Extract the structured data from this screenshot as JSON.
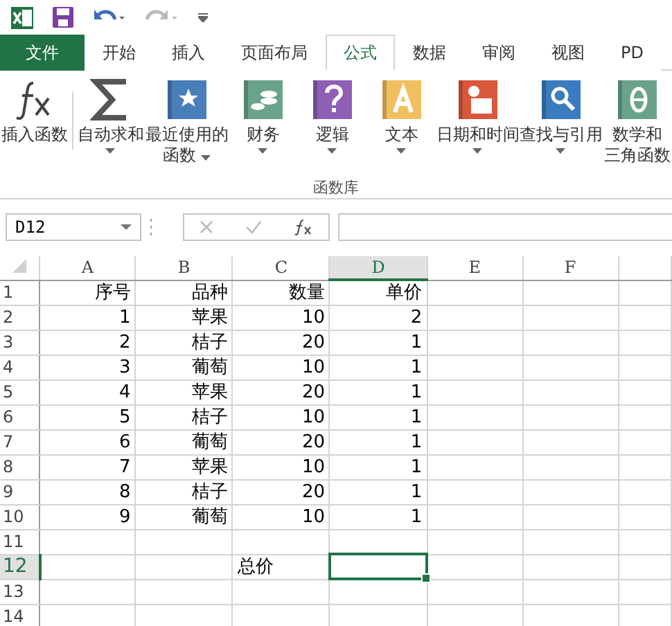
{
  "tabs": [
    {
      "label": "文件",
      "kind": "file",
      "selected": false
    },
    {
      "label": "开始",
      "kind": "tab",
      "selected": false
    },
    {
      "label": "插入",
      "kind": "tab",
      "selected": false
    },
    {
      "label": "页面布局",
      "kind": "tab",
      "selected": false
    },
    {
      "label": "公式",
      "kind": "tab",
      "selected": true
    },
    {
      "label": "数据",
      "kind": "tab",
      "selected": false
    },
    {
      "label": "审阅",
      "kind": "tab",
      "selected": false
    },
    {
      "label": "视图",
      "kind": "tab",
      "selected": false
    },
    {
      "label": "PD",
      "kind": "tab",
      "selected": false
    }
  ],
  "ribbon": {
    "group_label": "函数库",
    "items": [
      {
        "kind": "fx",
        "lines": [
          "插入函数"
        ],
        "dropdown": false
      },
      {
        "kind": "sum",
        "lines": [
          "自动求和"
        ],
        "dropdown": true
      },
      {
        "kind": "recent",
        "lines": [
          "最近使用的",
          "函数"
        ],
        "dropdown": true
      },
      {
        "kind": "finance",
        "lines": [
          "财务"
        ],
        "dropdown": true
      },
      {
        "kind": "logic",
        "lines": [
          "逻辑"
        ],
        "dropdown": true
      },
      {
        "kind": "text",
        "lines": [
          "文本"
        ],
        "dropdown": true
      },
      {
        "kind": "date",
        "lines": [
          "日期和时间"
        ],
        "dropdown": true
      },
      {
        "kind": "lookup",
        "lines": [
          "查找与引用"
        ],
        "dropdown": true
      },
      {
        "kind": "math",
        "lines": [
          "数学和",
          "三角函数"
        ],
        "dropdown": false
      }
    ]
  },
  "formula_bar": {
    "name_box": "D12"
  },
  "sheet": {
    "columns": [
      {
        "label": "A",
        "selected": false
      },
      {
        "label": "B",
        "selected": false
      },
      {
        "label": "C",
        "selected": false
      },
      {
        "label": "D",
        "selected": true
      },
      {
        "label": "E",
        "selected": false
      },
      {
        "label": "F",
        "selected": false
      }
    ],
    "rows": [
      {
        "label": "1",
        "selected": false,
        "cells": [
          "序号",
          "品种",
          "数量",
          "单价",
          "",
          ""
        ]
      },
      {
        "label": "2",
        "selected": false,
        "cells": [
          "1",
          "苹果",
          "10",
          "2",
          "",
          ""
        ]
      },
      {
        "label": "3",
        "selected": false,
        "cells": [
          "2",
          "桔子",
          "20",
          "1",
          "",
          ""
        ]
      },
      {
        "label": "4",
        "selected": false,
        "cells": [
          "3",
          "葡萄",
          "10",
          "1",
          "",
          ""
        ]
      },
      {
        "label": "5",
        "selected": false,
        "cells": [
          "4",
          "苹果",
          "20",
          "1",
          "",
          ""
        ]
      },
      {
        "label": "6",
        "selected": false,
        "cells": [
          "5",
          "桔子",
          "10",
          "1",
          "",
          ""
        ]
      },
      {
        "label": "7",
        "selected": false,
        "cells": [
          "6",
          "葡萄",
          "20",
          "1",
          "",
          ""
        ]
      },
      {
        "label": "8",
        "selected": false,
        "cells": [
          "7",
          "苹果",
          "10",
          "1",
          "",
          ""
        ]
      },
      {
        "label": "9",
        "selected": false,
        "cells": [
          "8",
          "桔子",
          "20",
          "1",
          "",
          ""
        ]
      },
      {
        "label": "10",
        "selected": false,
        "cells": [
          "9",
          "葡萄",
          "10",
          "1",
          "",
          ""
        ]
      },
      {
        "label": "11",
        "selected": false,
        "cells": [
          "",
          "",
          "",
          "",
          "",
          ""
        ]
      },
      {
        "label": "12",
        "selected": true,
        "kind": "total",
        "cells": [
          "",
          "",
          "总价",
          "",
          "",
          ""
        ]
      },
      {
        "label": "13",
        "selected": false,
        "cells": [
          "",
          "",
          "",
          "",
          "",
          ""
        ]
      },
      {
        "label": "14",
        "selected": false,
        "cells": [
          "",
          "",
          "",
          "",
          "",
          ""
        ]
      }
    ]
  }
}
